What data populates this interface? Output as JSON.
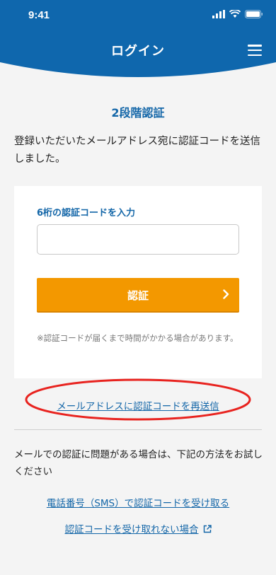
{
  "status_bar": {
    "time": "9:41"
  },
  "header": {
    "title": "ログイン",
    "menu_icon": "hamburger-menu-icon",
    "brand_color": "#0f67ad"
  },
  "page_title": "2段階認証",
  "intro": "登録いただいたメールアドレス宛に認証コードを送信しました。",
  "form": {
    "label": "6桁の認証コードを入力",
    "input_value": "",
    "input_placeholder": "",
    "submit_label": "認証",
    "submit_color": "#f39800",
    "note": "※認証コードが届くまで時間がかかる場合があります。"
  },
  "resend_link": "メールアドレスに認証コードを再送信",
  "help_text": "メールでの認証に問題がある場合は、下記の方法をお試しください",
  "links": {
    "sms": "電話番号（SMS）で認証コードを受け取る",
    "cant_receive": "認証コードを受け取れない場合"
  }
}
